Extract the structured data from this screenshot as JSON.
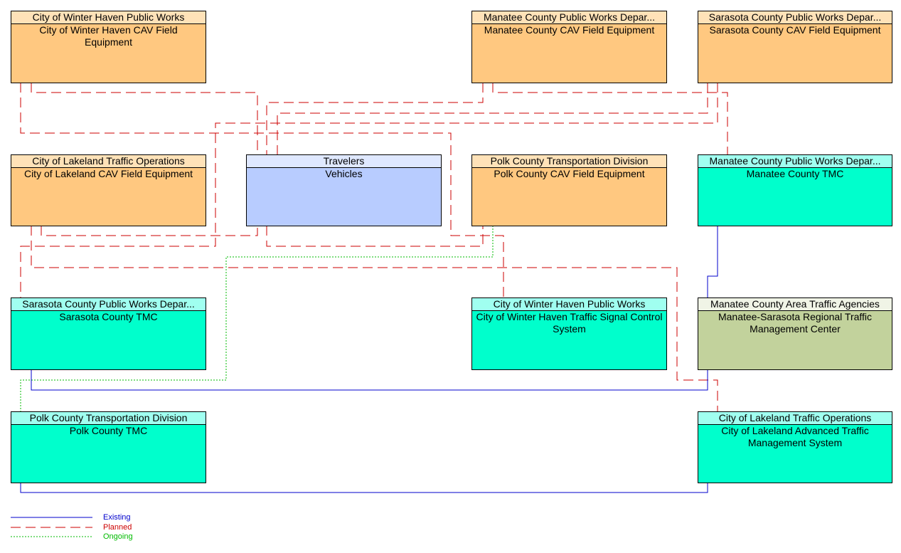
{
  "colors": {
    "existing": "#0000cc",
    "planned": "#cc0000",
    "ongoing": "#00bb00"
  },
  "boxes": {
    "wh_cav": {
      "owner": "City of Winter Haven Public Works",
      "name": "City of Winter Haven CAV Field Equipment"
    },
    "manatee_cav": {
      "owner": "Manatee County Public Works Depar...",
      "name": "Manatee County CAV Field Equipment"
    },
    "sarasota_cav": {
      "owner": "Sarasota County Public Works Depar...",
      "name": "Sarasota County CAV Field Equipment"
    },
    "lakeland_cav": {
      "owner": "City of Lakeland Traffic Operations",
      "name": "City of Lakeland CAV Field Equipment"
    },
    "vehicles": {
      "owner": "Travelers",
      "name": "Vehicles"
    },
    "polk_cav": {
      "owner": "Polk County Transportation Division",
      "name": "Polk County CAV Field Equipment"
    },
    "manatee_tmc": {
      "owner": "Manatee County Public Works Depar...",
      "name": "Manatee County TMC"
    },
    "sarasota_tmc": {
      "owner": "Sarasota County Public Works Depar...",
      "name": "Sarasota County TMC"
    },
    "wh_signal": {
      "owner": "City of Winter Haven Public Works",
      "name": "City of Winter Haven Traffic Signal Control System"
    },
    "rtmc": {
      "owner": "Manatee County Area Traffic Agencies",
      "name": "Manatee-Sarasota Regional Traffic Management Center"
    },
    "polk_tmc": {
      "owner": "Polk County Transportation Division",
      "name": "Polk County TMC"
    },
    "lakeland_atms": {
      "owner": "City of Lakeland Traffic Operations",
      "name": "City of Lakeland Advanced Traffic Management System"
    }
  },
  "legend": {
    "existing": "Existing",
    "planned": "Planned",
    "ongoing": "Ongoing"
  }
}
